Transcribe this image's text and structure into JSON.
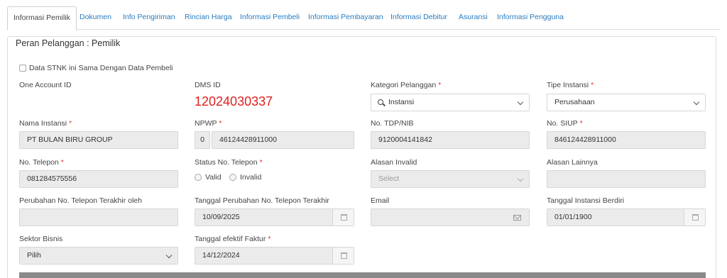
{
  "tabs": [
    {
      "label": "Informasi Pemilik",
      "active": true
    },
    {
      "label": "Dokumen"
    },
    {
      "label": "Info Pengiriman"
    },
    {
      "label": "Rincian Harga"
    },
    {
      "label": "Informasi Pembeli"
    },
    {
      "label": "Informasi Pembayaran"
    },
    {
      "label": "Informasi Debitur"
    },
    {
      "label": "Asuransi"
    },
    {
      "label": "Informasi Pengguna"
    }
  ],
  "panel": {
    "title": "Peran Pelanggan : Pemilik"
  },
  "same_as_buyer": {
    "label": "Data STNK ini Sama Dengan Data Pembeli",
    "checked": false
  },
  "required_mark": "*",
  "fields": {
    "one_account_id": {
      "label": "One Account ID"
    },
    "dms_id": {
      "label": "DMS ID",
      "value": "12024030337"
    },
    "kategori_pelanggan": {
      "label": "Kategori Pelanggan",
      "value": "Instansi"
    },
    "tipe_instansi": {
      "label": "Tipe Instansi",
      "value": "Perusahaan"
    },
    "nama_instansi": {
      "label": "Nama Instansi",
      "value": "PT BULAN BIRU GROUP"
    },
    "npwp": {
      "label": "NPWP",
      "prefix": "0",
      "value": "46124428911000"
    },
    "no_tdp": {
      "label": "No. TDP/NIB",
      "value": "9120004141842"
    },
    "no_siup": {
      "label": "No. SIUP",
      "value": "846124428911000"
    },
    "no_telepon": {
      "label": "No. Telepon",
      "value": "081284575556"
    },
    "status_telepon": {
      "label": "Status No. Telepon",
      "options": [
        "Valid",
        "Invalid"
      ]
    },
    "alasan_invalid": {
      "label": "Alasan Invalid",
      "placeholder": "Select"
    },
    "alasan_lainnya": {
      "label": "Alasan Lainnya",
      "value": ""
    },
    "perubahan_oleh": {
      "label": "Perubahan No. Telepon Terakhir oleh",
      "value": ""
    },
    "tanggal_perubahan": {
      "label": "Tanggal Perubahan No. Telepon Terakhir",
      "value": "10/09/2025"
    },
    "email": {
      "label": "Email",
      "value": ""
    },
    "tanggal_berdiri": {
      "label": "Tanggal Instansi Berdiri",
      "value": "01/01/1900"
    },
    "sektor_bisnis": {
      "label": "Sektor Bisnis",
      "value": "Pilih"
    },
    "tanggal_faktur": {
      "label": "Tanggal efektif Faktur",
      "value": "14/12/2024"
    }
  }
}
